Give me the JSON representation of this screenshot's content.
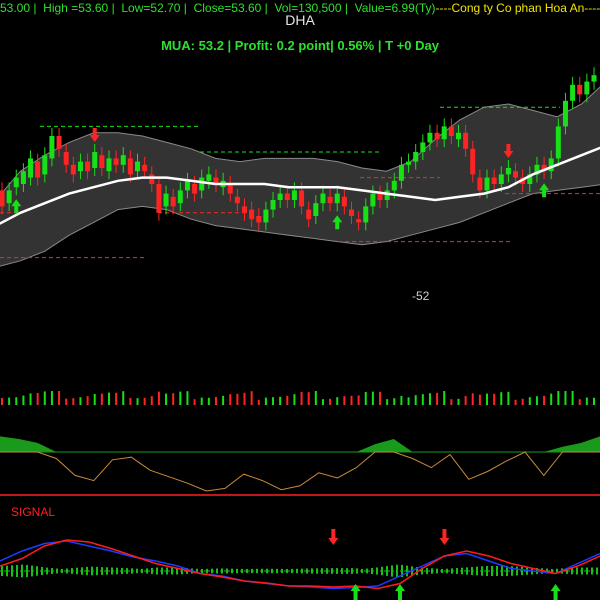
{
  "header": {
    "open": "53.00",
    "high_label": "High =",
    "high": "53.60",
    "low_label": "Low=",
    "low": "52.70",
    "close_label": "Close=",
    "close": "53.60",
    "vol_label": "Vol=",
    "vol": "130,500",
    "value_label": "Value=",
    "value": "6.99(Ty)",
    "company": "Cong ty Co phan Hoa An"
  },
  "ticker": "DHA",
  "signal_info": "MUA:  53.2  | Profit: 0.2 point| 0.56% | T +0 Day",
  "mid_value": "-52",
  "signal_label": "SIGNAL",
  "colors": {
    "up": "#17e017",
    "down": "#ff2424",
    "ma": "#ffffff",
    "band_fill": "#333333",
    "band_edge": "#8a8a8a",
    "support": "#ff2424",
    "resistance": "#17e017",
    "osc_fill": "#1a9a1a",
    "osc_line": "#c88a3c",
    "macd": "#1c3cff",
    "signal": "#ff1c1c",
    "hist": "#17c017",
    "header_green": "#2ee02e",
    "company": "#f2e600"
  },
  "chart_data": {
    "type": "candlestick",
    "title": "DHA",
    "candles": [
      {
        "o": 52.0,
        "c": 51.5
      },
      {
        "o": 51.6,
        "c": 52.0
      },
      {
        "o": 52.1,
        "c": 52.4
      },
      {
        "o": 52.2,
        "c": 52.6
      },
      {
        "o": 52.4,
        "c": 53.0
      },
      {
        "o": 52.9,
        "c": 52.4
      },
      {
        "o": 52.5,
        "c": 53.1
      },
      {
        "o": 53.0,
        "c": 53.7
      },
      {
        "o": 53.7,
        "c": 53.3
      },
      {
        "o": 53.2,
        "c": 52.8
      },
      {
        "o": 52.8,
        "c": 52.5
      },
      {
        "o": 52.6,
        "c": 52.9
      },
      {
        "o": 52.9,
        "c": 52.6
      },
      {
        "o": 52.7,
        "c": 53.2
      },
      {
        "o": 53.1,
        "c": 52.7
      },
      {
        "o": 52.6,
        "c": 53.0
      },
      {
        "o": 53.0,
        "c": 52.8
      },
      {
        "o": 52.8,
        "c": 53.1
      },
      {
        "o": 53.0,
        "c": 52.5
      },
      {
        "o": 52.6,
        "c": 52.9
      },
      {
        "o": 52.8,
        "c": 52.6
      },
      {
        "o": 52.5,
        "c": 52.2
      },
      {
        "o": 52.2,
        "c": 51.3
      },
      {
        "o": 51.5,
        "c": 51.9
      },
      {
        "o": 51.8,
        "c": 51.5
      },
      {
        "o": 51.6,
        "c": 52.0
      },
      {
        "o": 52.0,
        "c": 52.3
      },
      {
        "o": 52.2,
        "c": 51.9
      },
      {
        "o": 52.0,
        "c": 52.4
      },
      {
        "o": 52.3,
        "c": 52.5
      },
      {
        "o": 52.4,
        "c": 52.2
      },
      {
        "o": 52.1,
        "c": 52.3
      },
      {
        "o": 52.2,
        "c": 51.9
      },
      {
        "o": 51.8,
        "c": 51.6
      },
      {
        "o": 51.5,
        "c": 51.3
      },
      {
        "o": 51.4,
        "c": 51.1
      },
      {
        "o": 51.2,
        "c": 51.0
      },
      {
        "o": 51.0,
        "c": 51.4
      },
      {
        "o": 51.4,
        "c": 51.7
      },
      {
        "o": 51.7,
        "c": 51.9
      },
      {
        "o": 51.9,
        "c": 51.7
      },
      {
        "o": 51.7,
        "c": 52.0
      },
      {
        "o": 52.0,
        "c": 51.5
      },
      {
        "o": 51.4,
        "c": 51.1
      },
      {
        "o": 51.2,
        "c": 51.6
      },
      {
        "o": 51.6,
        "c": 51.9
      },
      {
        "o": 51.8,
        "c": 51.6
      },
      {
        "o": 51.6,
        "c": 51.9
      },
      {
        "o": 51.8,
        "c": 51.5
      },
      {
        "o": 51.4,
        "c": 51.2
      },
      {
        "o": 51.1,
        "c": 51.0
      },
      {
        "o": 51.0,
        "c": 51.5
      },
      {
        "o": 51.5,
        "c": 51.9
      },
      {
        "o": 51.9,
        "c": 51.7
      },
      {
        "o": 51.7,
        "c": 52.0
      },
      {
        "o": 52.0,
        "c": 52.3
      },
      {
        "o": 52.3,
        "c": 52.8
      },
      {
        "o": 52.8,
        "c": 52.9
      },
      {
        "o": 52.9,
        "c": 53.2
      },
      {
        "o": 53.2,
        "c": 53.5
      },
      {
        "o": 53.5,
        "c": 53.8
      },
      {
        "o": 53.8,
        "c": 53.6
      },
      {
        "o": 53.6,
        "c": 54.0
      },
      {
        "o": 54.0,
        "c": 53.7
      },
      {
        "o": 53.6,
        "c": 53.8
      },
      {
        "o": 53.8,
        "c": 53.3
      },
      {
        "o": 53.3,
        "c": 52.5
      },
      {
        "o": 52.4,
        "c": 52.0
      },
      {
        "o": 52.0,
        "c": 52.4
      },
      {
        "o": 52.4,
        "c": 52.2
      },
      {
        "o": 52.2,
        "c": 52.5
      },
      {
        "o": 52.5,
        "c": 52.7
      },
      {
        "o": 52.6,
        "c": 52.4
      },
      {
        "o": 52.4,
        "c": 52.2
      },
      {
        "o": 52.2,
        "c": 52.5
      },
      {
        "o": 52.5,
        "c": 52.8
      },
      {
        "o": 52.8,
        "c": 52.6
      },
      {
        "o": 52.6,
        "c": 53.0
      },
      {
        "o": 53.0,
        "c": 54.0
      },
      {
        "o": 54.0,
        "c": 54.8
      },
      {
        "o": 54.8,
        "c": 55.3
      },
      {
        "o": 55.3,
        "c": 55.0
      },
      {
        "o": 55.0,
        "c": 55.4
      },
      {
        "o": 55.4,
        "c": 55.6
      }
    ],
    "bollinger": {
      "ma": [
        50.9,
        51.3,
        51.6,
        51.9,
        52.1,
        52.3,
        52.4,
        52.4,
        52.3,
        52.2,
        52.2,
        52.2,
        52.1,
        52.1,
        52.1,
        52.0,
        51.9,
        51.8,
        51.7,
        51.8,
        51.9,
        52.1,
        52.5,
        52.8,
        53.1,
        53.4
      ],
      "upper": [
        51.7,
        52.6,
        53.1,
        53.5,
        53.8,
        53.8,
        53.7,
        53.5,
        53.3,
        53.0,
        52.9,
        53.0,
        53.0,
        53.0,
        52.9,
        52.7,
        52.6,
        52.9,
        53.6,
        54.2,
        54.6,
        54.7,
        54.5,
        54.3,
        54.7,
        55.4
      ],
      "lower": [
        49.6,
        49.8,
        50.1,
        50.6,
        51.0,
        51.4,
        51.5,
        51.4,
        51.1,
        50.9,
        50.8,
        50.7,
        50.6,
        50.5,
        50.4,
        50.3,
        50.4,
        50.6,
        50.8,
        51.0,
        51.3,
        51.6,
        51.9,
        52.0,
        52.1,
        52.2
      ]
    },
    "buy_signals": [
      2,
      47,
      76
    ],
    "sell_signals": [
      13,
      71
    ],
    "oscillator": [
      12,
      10,
      7,
      -5,
      -18,
      -22,
      -6,
      -4,
      -14,
      -19,
      -24,
      -30,
      -28,
      -17,
      -22,
      -29,
      -26,
      -16,
      -20,
      -12,
      6,
      10,
      -5,
      -12,
      -2,
      -21,
      -15,
      -7,
      0,
      -18,
      4,
      7,
      12
    ],
    "macd": [
      0.2,
      0.4,
      0.55,
      0.6,
      0.5,
      0.4,
      0.28,
      0.2,
      0.1,
      -0.05,
      -0.1,
      -0.2,
      -0.25,
      -0.3,
      -0.32,
      -0.35,
      -0.33,
      -0.3,
      -0.1,
      0.1,
      0.3,
      0.35,
      0.2,
      0.05,
      0.0,
      -0.05,
      0.15,
      0.35
    ],
    "signal": [
      0.1,
      0.25,
      0.5,
      0.62,
      0.58,
      0.45,
      0.3,
      0.15,
      0.05,
      -0.05,
      -0.12,
      -0.2,
      -0.24,
      -0.3,
      -0.3,
      -0.32,
      -0.3,
      -0.35,
      -0.25,
      0.05,
      0.3,
      0.4,
      0.3,
      0.15,
      0.05,
      -0.05,
      0.1,
      0.3
    ],
    "macd_buy_signals": [
      16,
      18,
      25
    ],
    "macd_sell_signals": [
      15,
      20
    ]
  }
}
